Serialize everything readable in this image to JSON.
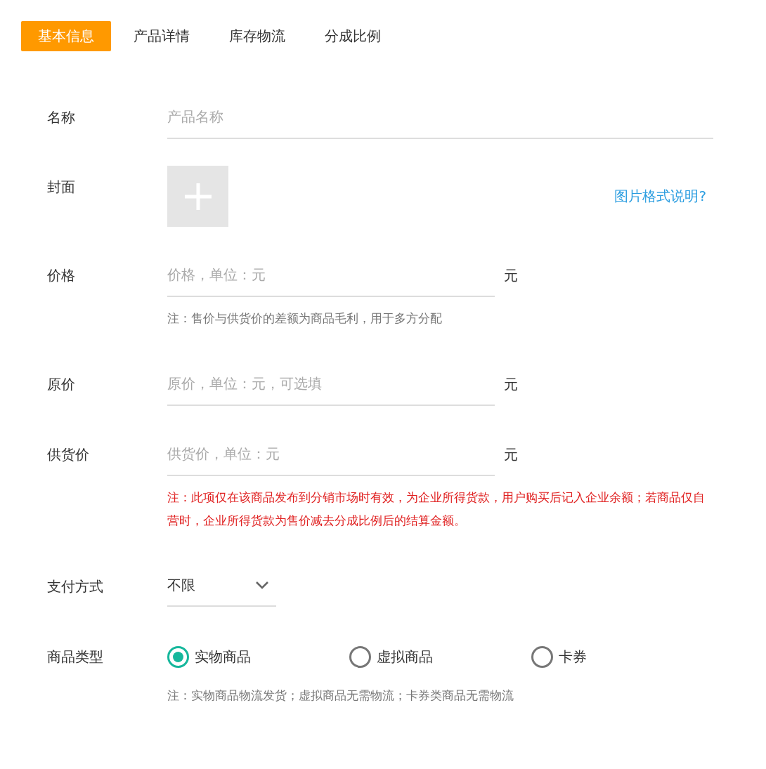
{
  "tabs": [
    {
      "label": "基本信息",
      "selected": true
    },
    {
      "label": "产品详情",
      "selected": false
    },
    {
      "label": "库存物流",
      "selected": false
    },
    {
      "label": "分成比例",
      "selected": false
    }
  ],
  "fields": [
    {
      "kind": "text",
      "label": "名称",
      "placeholder": "产品名称"
    },
    {
      "kind": "image",
      "label": "封面",
      "link": "图片格式说明?"
    },
    {
      "kind": "text",
      "label": "价格",
      "placeholder": "价格，单位：元",
      "unit": "元",
      "note": {
        "text": "注：售价与供货价的差额为商品毛利，用于多方分配",
        "warning": false
      }
    },
    {
      "kind": "text",
      "label": "原价",
      "placeholder": "原价，单位：元，可选填",
      "unit": "元"
    },
    {
      "kind": "text",
      "label": "供货价",
      "placeholder": "供货价，单位：元",
      "unit": "元",
      "note": {
        "text": "注：此项仅在该商品发布到分销市场时有效，为企业所得货款，用户购买后记入企业余额；若商品仅自营时，企业所得货款为售价减去分成比例后的结算金额。",
        "warning": true
      }
    },
    {
      "kind": "select",
      "label": "支付方式",
      "value": "不限"
    },
    {
      "kind": "radio",
      "label": "商品类型",
      "options": [
        {
          "label": "实物商品",
          "selected": true
        },
        {
          "label": "虚拟商品",
          "selected": false
        },
        {
          "label": "卡券",
          "selected": false
        }
      ],
      "note": {
        "text": "注：实物商品物流发货；虚拟商品无需物流；卡券类商品无需物流",
        "warning": false
      }
    }
  ]
}
